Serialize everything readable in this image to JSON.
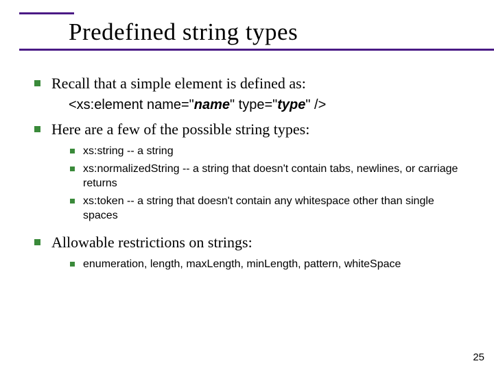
{
  "title": "Predefined string types",
  "bullets": [
    {
      "text": "Recall that a simple element is defined as:",
      "code": {
        "seg1": "<xs:element  name=\"",
        "ital1": "name",
        "seg2": "\"  type=\"",
        "ital2": "type",
        "seg3": "\" />"
      }
    },
    {
      "text": "Here are a few of the possible string types:",
      "subs": [
        {
          "label": "xs:string",
          "desc": " -- a string"
        },
        {
          "label": "xs:normalizedString",
          "desc": " -- a string that doesn't contain tabs, newlines, or carriage returns"
        },
        {
          "label": "xs:token",
          "desc": " -- a string that doesn't contain any whitespace other than single spaces"
        }
      ]
    },
    {
      "text": "Allowable restrictions on strings:",
      "subs": [
        {
          "text": " enumeration, length, maxLength, minLength, pattern, whiteSpace"
        }
      ]
    }
  ],
  "page": "25"
}
